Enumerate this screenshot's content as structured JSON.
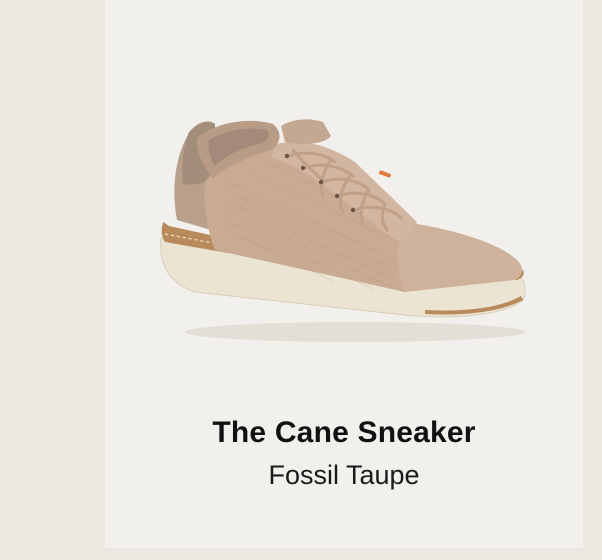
{
  "product": {
    "name": "The Cane Sneaker",
    "color": "Fossil Taupe"
  },
  "colors": {
    "page_background": "#ece8e1",
    "card_background": "#f2f0ec",
    "shoe_upper": "#c9ab94",
    "shoe_sole": "#ece4d2",
    "shoe_trim": "#b98b5c"
  },
  "image": {
    "icon": "sneaker-image"
  }
}
